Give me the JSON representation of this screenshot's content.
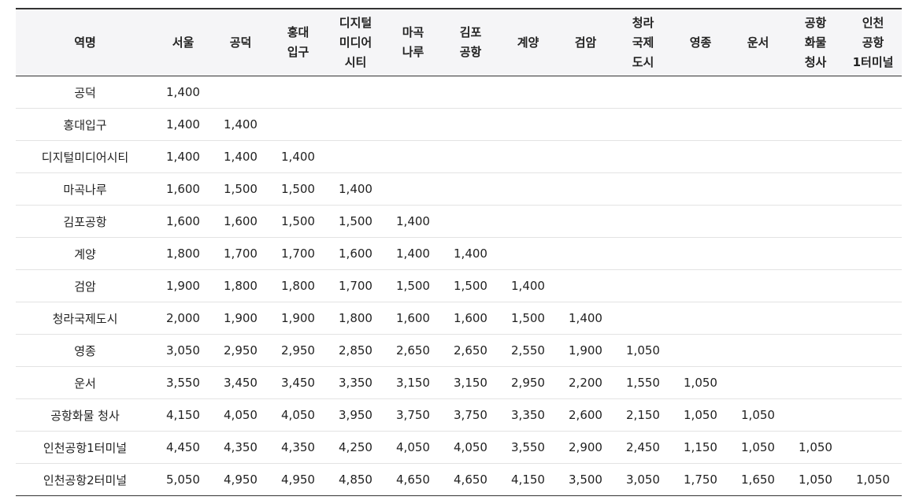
{
  "table": {
    "columns": [
      "역명",
      "서울",
      "공덕",
      "홍대\n입구",
      "디지털\n미디어\n시티",
      "마곡\n나루",
      "김포\n공항",
      "계양",
      "검암",
      "청라\n국제\n도시",
      "영종",
      "운서",
      "공항\n화물\n청사",
      "인천\n공항\n1터미널"
    ],
    "rows": [
      [
        "공덕",
        "1,400",
        "",
        "",
        "",
        "",
        "",
        "",
        "",
        "",
        "",
        "",
        "",
        ""
      ],
      [
        "홍대입구",
        "1,400",
        "1,400",
        "",
        "",
        "",
        "",
        "",
        "",
        "",
        "",
        "",
        "",
        ""
      ],
      [
        "디지털미디어시티",
        "1,400",
        "1,400",
        "1,400",
        "",
        "",
        "",
        "",
        "",
        "",
        "",
        "",
        "",
        ""
      ],
      [
        "마곡나루",
        "1,600",
        "1,500",
        "1,500",
        "1,400",
        "",
        "",
        "",
        "",
        "",
        "",
        "",
        "",
        ""
      ],
      [
        "김포공항",
        "1,600",
        "1,600",
        "1,500",
        "1,500",
        "1,400",
        "",
        "",
        "",
        "",
        "",
        "",
        "",
        ""
      ],
      [
        "계양",
        "1,800",
        "1,700",
        "1,700",
        "1,600",
        "1,400",
        "1,400",
        "",
        "",
        "",
        "",
        "",
        "",
        ""
      ],
      [
        "검암",
        "1,900",
        "1,800",
        "1,800",
        "1,700",
        "1,500",
        "1,500",
        "1,400",
        "",
        "",
        "",
        "",
        "",
        ""
      ],
      [
        "청라국제도시",
        "2,000",
        "1,900",
        "1,900",
        "1,800",
        "1,600",
        "1,600",
        "1,500",
        "1,400",
        "",
        "",
        "",
        "",
        ""
      ],
      [
        "영종",
        "3,050",
        "2,950",
        "2,950",
        "2,850",
        "2,650",
        "2,650",
        "2,550",
        "1,900",
        "1,050",
        "",
        "",
        "",
        ""
      ],
      [
        "운서",
        "3,550",
        "3,450",
        "3,450",
        "3,350",
        "3,150",
        "3,150",
        "2,950",
        "2,200",
        "1,550",
        "1,050",
        "",
        "",
        ""
      ],
      [
        "공항화물 청사",
        "4,150",
        "4,050",
        "4,050",
        "3,950",
        "3,750",
        "3,750",
        "3,350",
        "2,600",
        "2,150",
        "1,050",
        "1,050",
        "",
        ""
      ],
      [
        "인천공항1터미널",
        "4,450",
        "4,350",
        "4,350",
        "4,250",
        "4,050",
        "4,050",
        "3,550",
        "2,900",
        "2,450",
        "1,150",
        "1,050",
        "1,050",
        ""
      ],
      [
        "인천공항2터미널",
        "5,050",
        "4,950",
        "4,950",
        "4,850",
        "4,650",
        "4,650",
        "4,150",
        "3,500",
        "3,050",
        "1,750",
        "1,650",
        "1,050",
        "1,050"
      ]
    ]
  }
}
